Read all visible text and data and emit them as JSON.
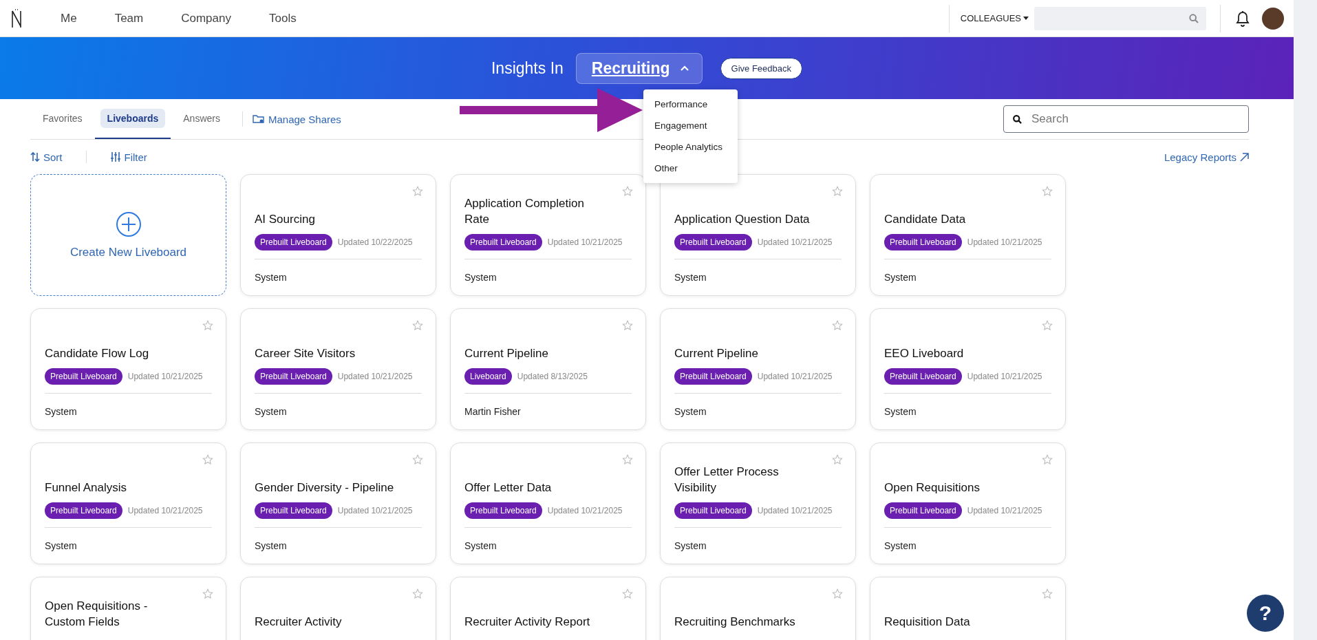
{
  "nav": {
    "items": [
      {
        "label": "Me"
      },
      {
        "label": "Team"
      },
      {
        "label": "Company"
      },
      {
        "label": "Tools"
      }
    ],
    "colleagues": "COLLEAGUES"
  },
  "banner": {
    "prefix": "Insights In",
    "area": "Recruiting",
    "expanded": true,
    "feedback": "Give Feedback"
  },
  "area_menu": [
    "Performance",
    "Engagement",
    "People Analytics",
    "Other"
  ],
  "tabs": [
    {
      "label": "Favorites",
      "selected": false
    },
    {
      "label": "Liveboards",
      "selected": true
    },
    {
      "label": "Answers",
      "selected": false
    }
  ],
  "manage_shares": "Manage Shares",
  "search": {
    "placeholder": "Search"
  },
  "sort": "Sort",
  "filter": "Filter",
  "legacy_reports": "Legacy Reports",
  "create_card": "Create New Liveboard",
  "cards": [
    {
      "title": "AI Sourcing",
      "badge": "Prebuilt Liveboard",
      "updated": "Updated 10/22/2025",
      "owner": "System",
      "starred": false
    },
    {
      "title": "Application Completion Rate",
      "badge": "Prebuilt Liveboard",
      "updated": "Updated 10/21/2025",
      "owner": "System",
      "starred": false
    },
    {
      "title": "Application Question Data",
      "badge": "Prebuilt Liveboard",
      "updated": "Updated 10/21/2025",
      "owner": "System",
      "starred": false
    },
    {
      "title": "Candidate Data",
      "badge": "Prebuilt Liveboard",
      "updated": "Updated 10/21/2025",
      "owner": "System",
      "starred": false
    },
    {
      "title": "Candidate Flow Log",
      "badge": "Prebuilt Liveboard",
      "updated": "Updated 10/21/2025",
      "owner": "System",
      "starred": false
    },
    {
      "title": "Career Site Visitors",
      "badge": "Prebuilt Liveboard",
      "updated": "Updated 10/21/2025",
      "owner": "System",
      "starred": false
    },
    {
      "title": "Current Pipeline",
      "badge": "Liveboard",
      "updated": "Updated 8/13/2025",
      "owner": "Martin Fisher",
      "starred": false
    },
    {
      "title": "Current Pipeline",
      "badge": "Prebuilt Liveboard",
      "updated": "Updated 10/21/2025",
      "owner": "System",
      "starred": false
    },
    {
      "title": "EEO Liveboard",
      "badge": "Prebuilt Liveboard",
      "updated": "Updated 10/21/2025",
      "owner": "System",
      "starred": false
    },
    {
      "title": "Funnel Analysis",
      "badge": "Prebuilt Liveboard",
      "updated": "Updated 10/21/2025",
      "owner": "System",
      "starred": false
    },
    {
      "title": "Gender Diversity - Pipeline",
      "badge": "Prebuilt Liveboard",
      "updated": "Updated 10/21/2025",
      "owner": "System",
      "starred": false
    },
    {
      "title": "Offer Letter Data",
      "badge": "Prebuilt Liveboard",
      "updated": "Updated 10/21/2025",
      "owner": "System",
      "starred": false
    },
    {
      "title": "Offer Letter Process Visibility",
      "badge": "Prebuilt Liveboard",
      "updated": "Updated 10/21/2025",
      "owner": "System",
      "starred": false
    },
    {
      "title": "Open Requisitions",
      "badge": "Prebuilt Liveboard",
      "updated": "Updated 10/21/2025",
      "owner": "System",
      "starred": false
    },
    {
      "title": "Open Requisitions - Custom Fields",
      "starred": false
    },
    {
      "title": "Recruiter Activity",
      "starred": false
    },
    {
      "title": "Recruiter Activity Report",
      "starred": false
    },
    {
      "title": "Recruiting Benchmarks",
      "starred": false
    },
    {
      "title": "Requisition Data",
      "starred": false
    }
  ],
  "help": "?"
}
